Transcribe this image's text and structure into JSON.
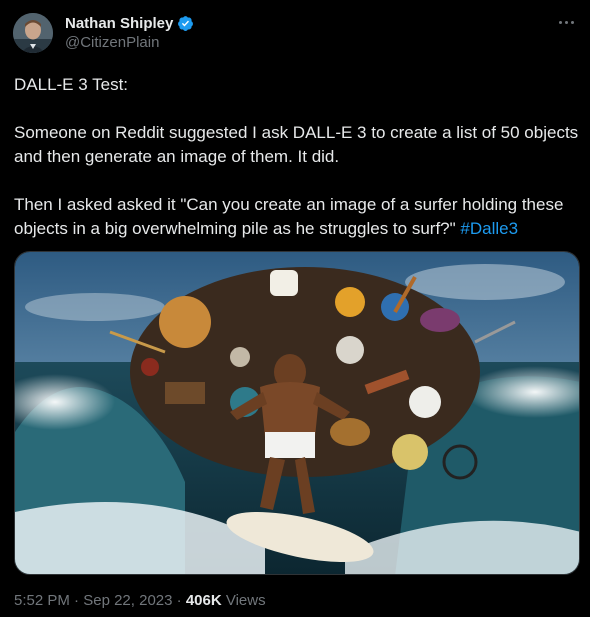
{
  "author": {
    "display_name": "Nathan Shipley",
    "handle": "@CitizenPlain",
    "verified": true,
    "icons": {
      "avatar": "avatar",
      "verified": "verified-badge-icon",
      "more": "more-options-icon"
    }
  },
  "tweet": {
    "line1": "DALL-E 3 Test:",
    "para2": "Someone on Reddit suggested I ask DALL-E 3 to create a list of 50 objects and then generate an image of them.  It did.",
    "para3": "Then I asked asked it \"Can you create an image of a surfer holding these objects in a big overwhelming pile as he struggles to surf?\" ",
    "hashtag": "#Dalle3"
  },
  "meta": {
    "time": "5:52 PM",
    "sep1": " · ",
    "date": "Sep 22, 2023",
    "sep2": " · ",
    "views_count": "406K",
    "views_label": " Views"
  },
  "colors": {
    "background": "#000000",
    "text": "#e7e9ea",
    "secondary": "#71767b",
    "link": "#1d9bf0",
    "verified": "#1d9bf0"
  }
}
